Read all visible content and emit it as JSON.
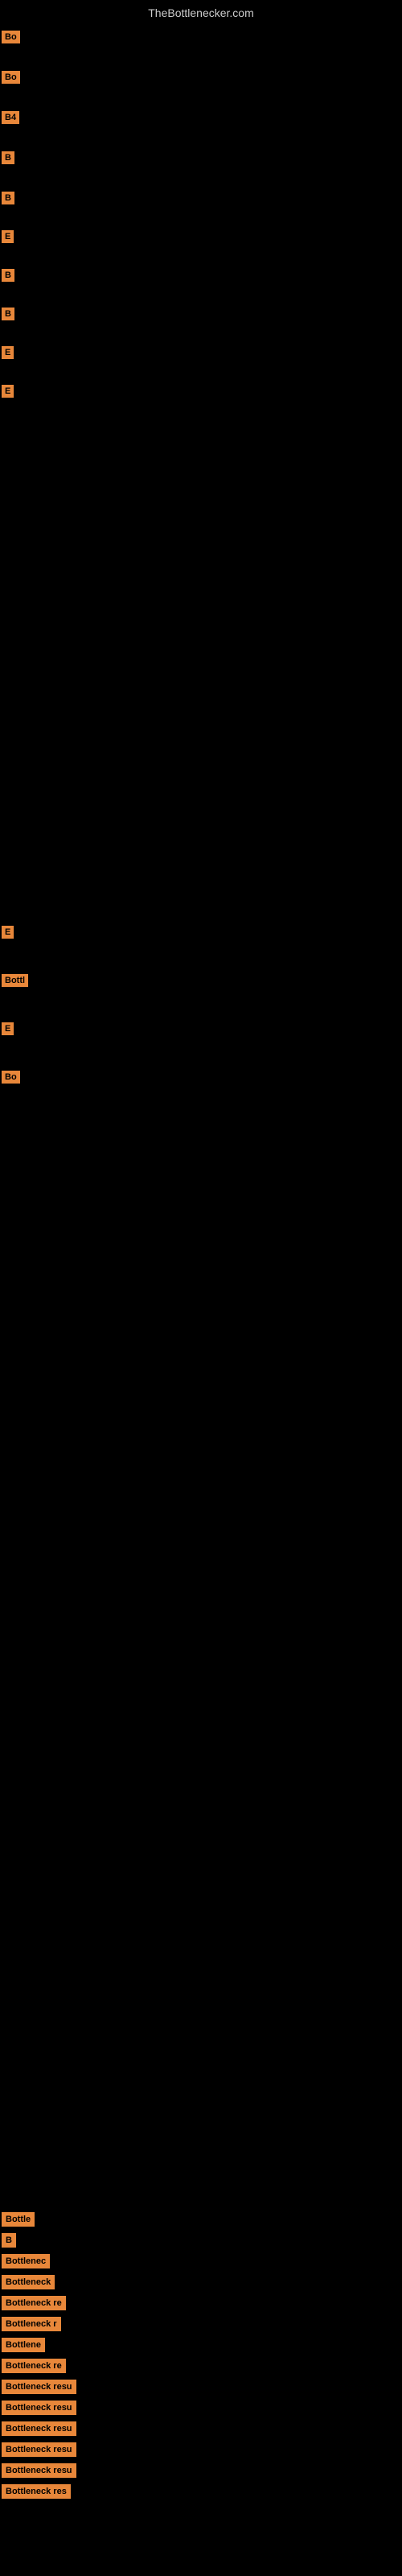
{
  "site": {
    "title": "TheBottlenecker.com"
  },
  "top_badges": [
    {
      "id": "b1",
      "label": "Bo"
    },
    {
      "id": "b2",
      "label": "Bo"
    },
    {
      "id": "b3",
      "label": "B4"
    },
    {
      "id": "b4",
      "label": "B"
    },
    {
      "id": "b5",
      "label": "B"
    },
    {
      "id": "b6",
      "label": "E"
    },
    {
      "id": "b7",
      "label": "B"
    },
    {
      "id": "b8",
      "label": "B"
    },
    {
      "id": "b9",
      "label": "E"
    },
    {
      "id": "b10",
      "label": "E"
    }
  ],
  "middle_badges": [
    {
      "id": "m1",
      "label": "E"
    },
    {
      "id": "m2",
      "label": "Bottl"
    },
    {
      "id": "m3",
      "label": "E"
    },
    {
      "id": "m4",
      "label": "Bo"
    }
  ],
  "lower_badges": [
    {
      "id": "l1",
      "label": "Bottle"
    },
    {
      "id": "l2",
      "label": "B"
    },
    {
      "id": "l3",
      "label": "Bottlenec"
    },
    {
      "id": "l4",
      "label": "Bottleneck"
    },
    {
      "id": "l5",
      "label": "Bottleneck re"
    },
    {
      "id": "l6",
      "label": "Bottleneck r"
    },
    {
      "id": "l7",
      "label": "Bottlene"
    },
    {
      "id": "l8",
      "label": "Bottleneck re"
    },
    {
      "id": "l9",
      "label": "Bottleneck resu"
    },
    {
      "id": "l10",
      "label": "Bottleneck resu"
    },
    {
      "id": "l11",
      "label": "Bottleneck resu"
    },
    {
      "id": "l12",
      "label": "Bottleneck resu"
    },
    {
      "id": "l13",
      "label": "Bottleneck resu"
    },
    {
      "id": "l14",
      "label": "Bottleneck res"
    }
  ]
}
